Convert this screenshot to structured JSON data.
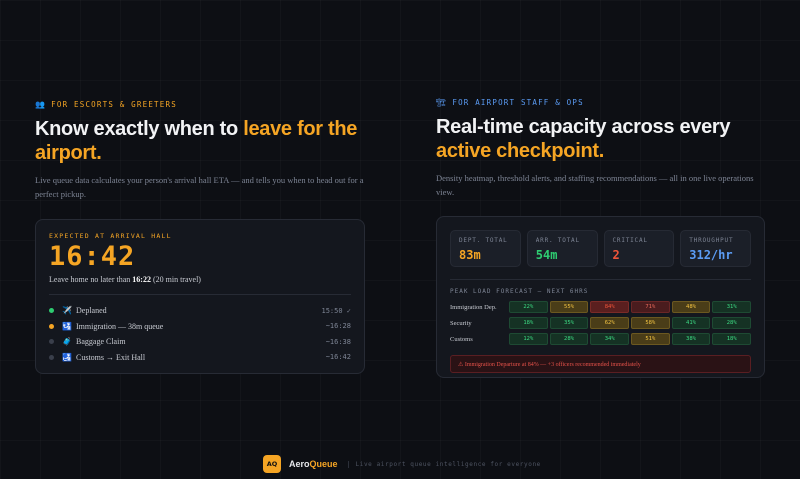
{
  "colors": {
    "accent": "#f5a524",
    "blue": "#5b9cf5",
    "green": "#2ecc71",
    "red": "#f0553a",
    "dot_done": "#2ecc71",
    "dot_active": "#f5a524",
    "dot_pending": "#3a3f4b"
  },
  "left": {
    "kicker_icon": "people-icon",
    "kicker_glyph": "👥",
    "kicker": "FOR ESCORTS & GREETERS",
    "headline_plain": "Know exactly when to ",
    "headline_accent": "leave for the airport.",
    "subtitle": "Live queue data calculates your person's arrival hall ETA — and tells you when to head out for a perfect pickup.",
    "card": {
      "kicker": "EXPECTED AT ARRIVAL HALL",
      "eta": "16:42",
      "leave_prefix": "Leave home no later than ",
      "leave_time": "16:22",
      "leave_suffix": " (20 min travel)",
      "steps": [
        {
          "icon": "plane-icon",
          "glyph": "✈️",
          "label": "Deplaned",
          "time": "15:50 ✓",
          "state": "done"
        },
        {
          "icon": "passport-icon",
          "glyph": "🛂",
          "label": "Immigration — 38m queue",
          "time": "~16:28",
          "state": "active"
        },
        {
          "icon": "luggage-icon",
          "glyph": "🧳",
          "label": "Baggage Claim",
          "time": "~16:38",
          "state": "pending"
        },
        {
          "icon": "customs-icon",
          "glyph": "🛃",
          "label": "Customs → Exit Hall",
          "time": "~16:42",
          "state": "pending"
        }
      ]
    }
  },
  "right": {
    "kicker_icon": "building-icon",
    "kicker_glyph": "🏗",
    "kicker": "FOR AIRPORT STAFF & OPS",
    "headline_plain": "Real-time capacity across every ",
    "headline_accent": "active checkpoint.",
    "subtitle": "Density heatmap, threshold alerts, and staffing recommendations — all in one live operations view.",
    "stats": [
      {
        "label": "DEPT. TOTAL",
        "value": "83m",
        "color": "#f5a524"
      },
      {
        "label": "ARR. TOTAL",
        "value": "54m",
        "color": "#2ecc71"
      },
      {
        "label": "CRITICAL",
        "value": "2",
        "color": "#f0553a"
      },
      {
        "label": "THROUGHPUT",
        "value": "312/hr",
        "color": "#5b9cf5"
      }
    ],
    "forecast_title": "PEAK LOAD FORECAST — NEXT 6HRS",
    "heatmap": [
      {
        "label": "Immigration Dep.",
        "cells": [
          22,
          55,
          84,
          71,
          48,
          31
        ]
      },
      {
        "label": "Security",
        "cells": [
          18,
          35,
          62,
          58,
          41,
          28
        ]
      },
      {
        "label": "Customs",
        "cells": [
          12,
          28,
          34,
          51,
          38,
          18
        ]
      }
    ],
    "alert": "⚠ Immigration Departure at 84% — +3 officers recommended immediately"
  },
  "footer": {
    "logo": "AQ",
    "brand_a": "Aero",
    "brand_b": "Queue",
    "tagline": "Live airport queue intelligence for everyone"
  }
}
